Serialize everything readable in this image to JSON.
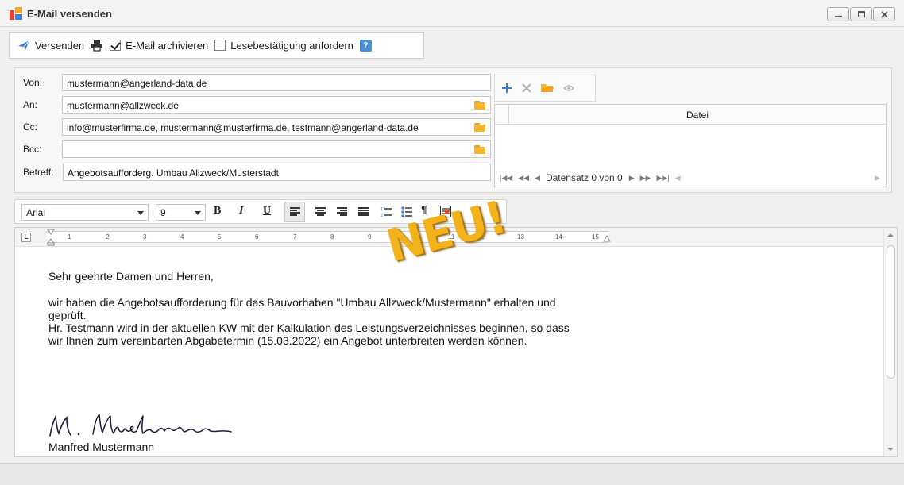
{
  "window": {
    "title": "E-Mail versenden"
  },
  "toolbar": {
    "send_label": "Versenden",
    "archive_label": "E-Mail archivieren",
    "archive_checked": true,
    "read_receipt_label": "Lesebestätigung anfordern",
    "read_receipt_checked": false,
    "help_label": "?"
  },
  "fields": {
    "from_label": "Von:",
    "from_value": "mustermann@angerland-data.de",
    "to_label": "An:",
    "to_value": "mustermann@allzweck.de",
    "cc_label": "Cc:",
    "cc_value": "info@musterfirma.de, mustermann@musterfirma.de, testmann@angerland-data.de",
    "bcc_label": "Bcc:",
    "bcc_value": "",
    "subject_label": "Betreff:",
    "subject_value": "Angebotsaufforderg. Umbau Allzweck/Musterstadt"
  },
  "attachments": {
    "column_header": "Datei",
    "navigator_text": "Datensatz 0 von 0"
  },
  "format": {
    "font_name": "Arial",
    "font_size": "9",
    "bold_label": "B",
    "italic_label": "I",
    "underline_label": "U",
    "paragraph_label": "¶"
  },
  "ruler": {
    "numbers": [
      "1",
      "2",
      "3",
      "4",
      "5",
      "6",
      "7",
      "8",
      "9",
      "11",
      "2",
      "13",
      "14",
      "15"
    ]
  },
  "body": {
    "salutation": "Sehr geehrte Damen und Herren,",
    "line1": "wir haben die Angebotsaufforderung für das Bauvorhaben \"Umbau Allzweck/Mustermann\" erhalten und",
    "line2": "geprüft.",
    "line3": "Hr. Testmann wird in der aktuellen KW mit der Kalkulation des Leistungsverzeichnisses beginnen, so dass",
    "line4": "wir Ihnen zum vereinbarten Abgabetermin (15.03.2022) ein Angebot unterbreiten werden können.",
    "sender_name": "Manfred Mustermann"
  },
  "badge": {
    "text": "NEU!"
  },
  "colors": {
    "accent_blue": "#3a7fd5",
    "folder_orange": "#f6b32d",
    "stamp_gold": "#f2b21c"
  }
}
